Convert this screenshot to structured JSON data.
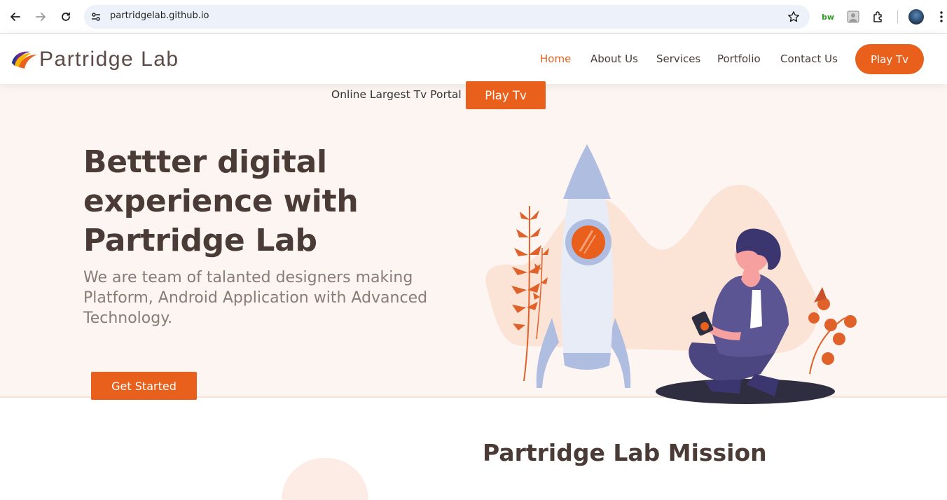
{
  "browser": {
    "url": "partridgelab.github.io",
    "extensions": [
      "bw-icon",
      "profile-photo-icon",
      "puzzle-icon"
    ]
  },
  "site": {
    "logo_text": "Partridge Lab",
    "nav": {
      "items": [
        {
          "label": "Home",
          "active": true
        },
        {
          "label": "About Us",
          "active": false
        },
        {
          "label": "Services",
          "active": false
        },
        {
          "label": "Portfolio",
          "active": false
        },
        {
          "label": "Contact Us",
          "active": false
        }
      ],
      "cta_label": "Play Tv"
    },
    "promo": {
      "text": "Online Largest Tv Portal",
      "button_label": "Play Tv"
    },
    "hero": {
      "title": "Bettter digital experience with Partridge Lab",
      "subtitle": "We are team of talanted designers making Platform, Android Application with Advanced Technology.",
      "cta_label": "Get Started"
    },
    "mission": {
      "title": "Partridge Lab Mission"
    },
    "colors": {
      "accent": "#e8601c",
      "heading": "#4a3b36",
      "hero_bg": "#fcf5f1"
    }
  }
}
